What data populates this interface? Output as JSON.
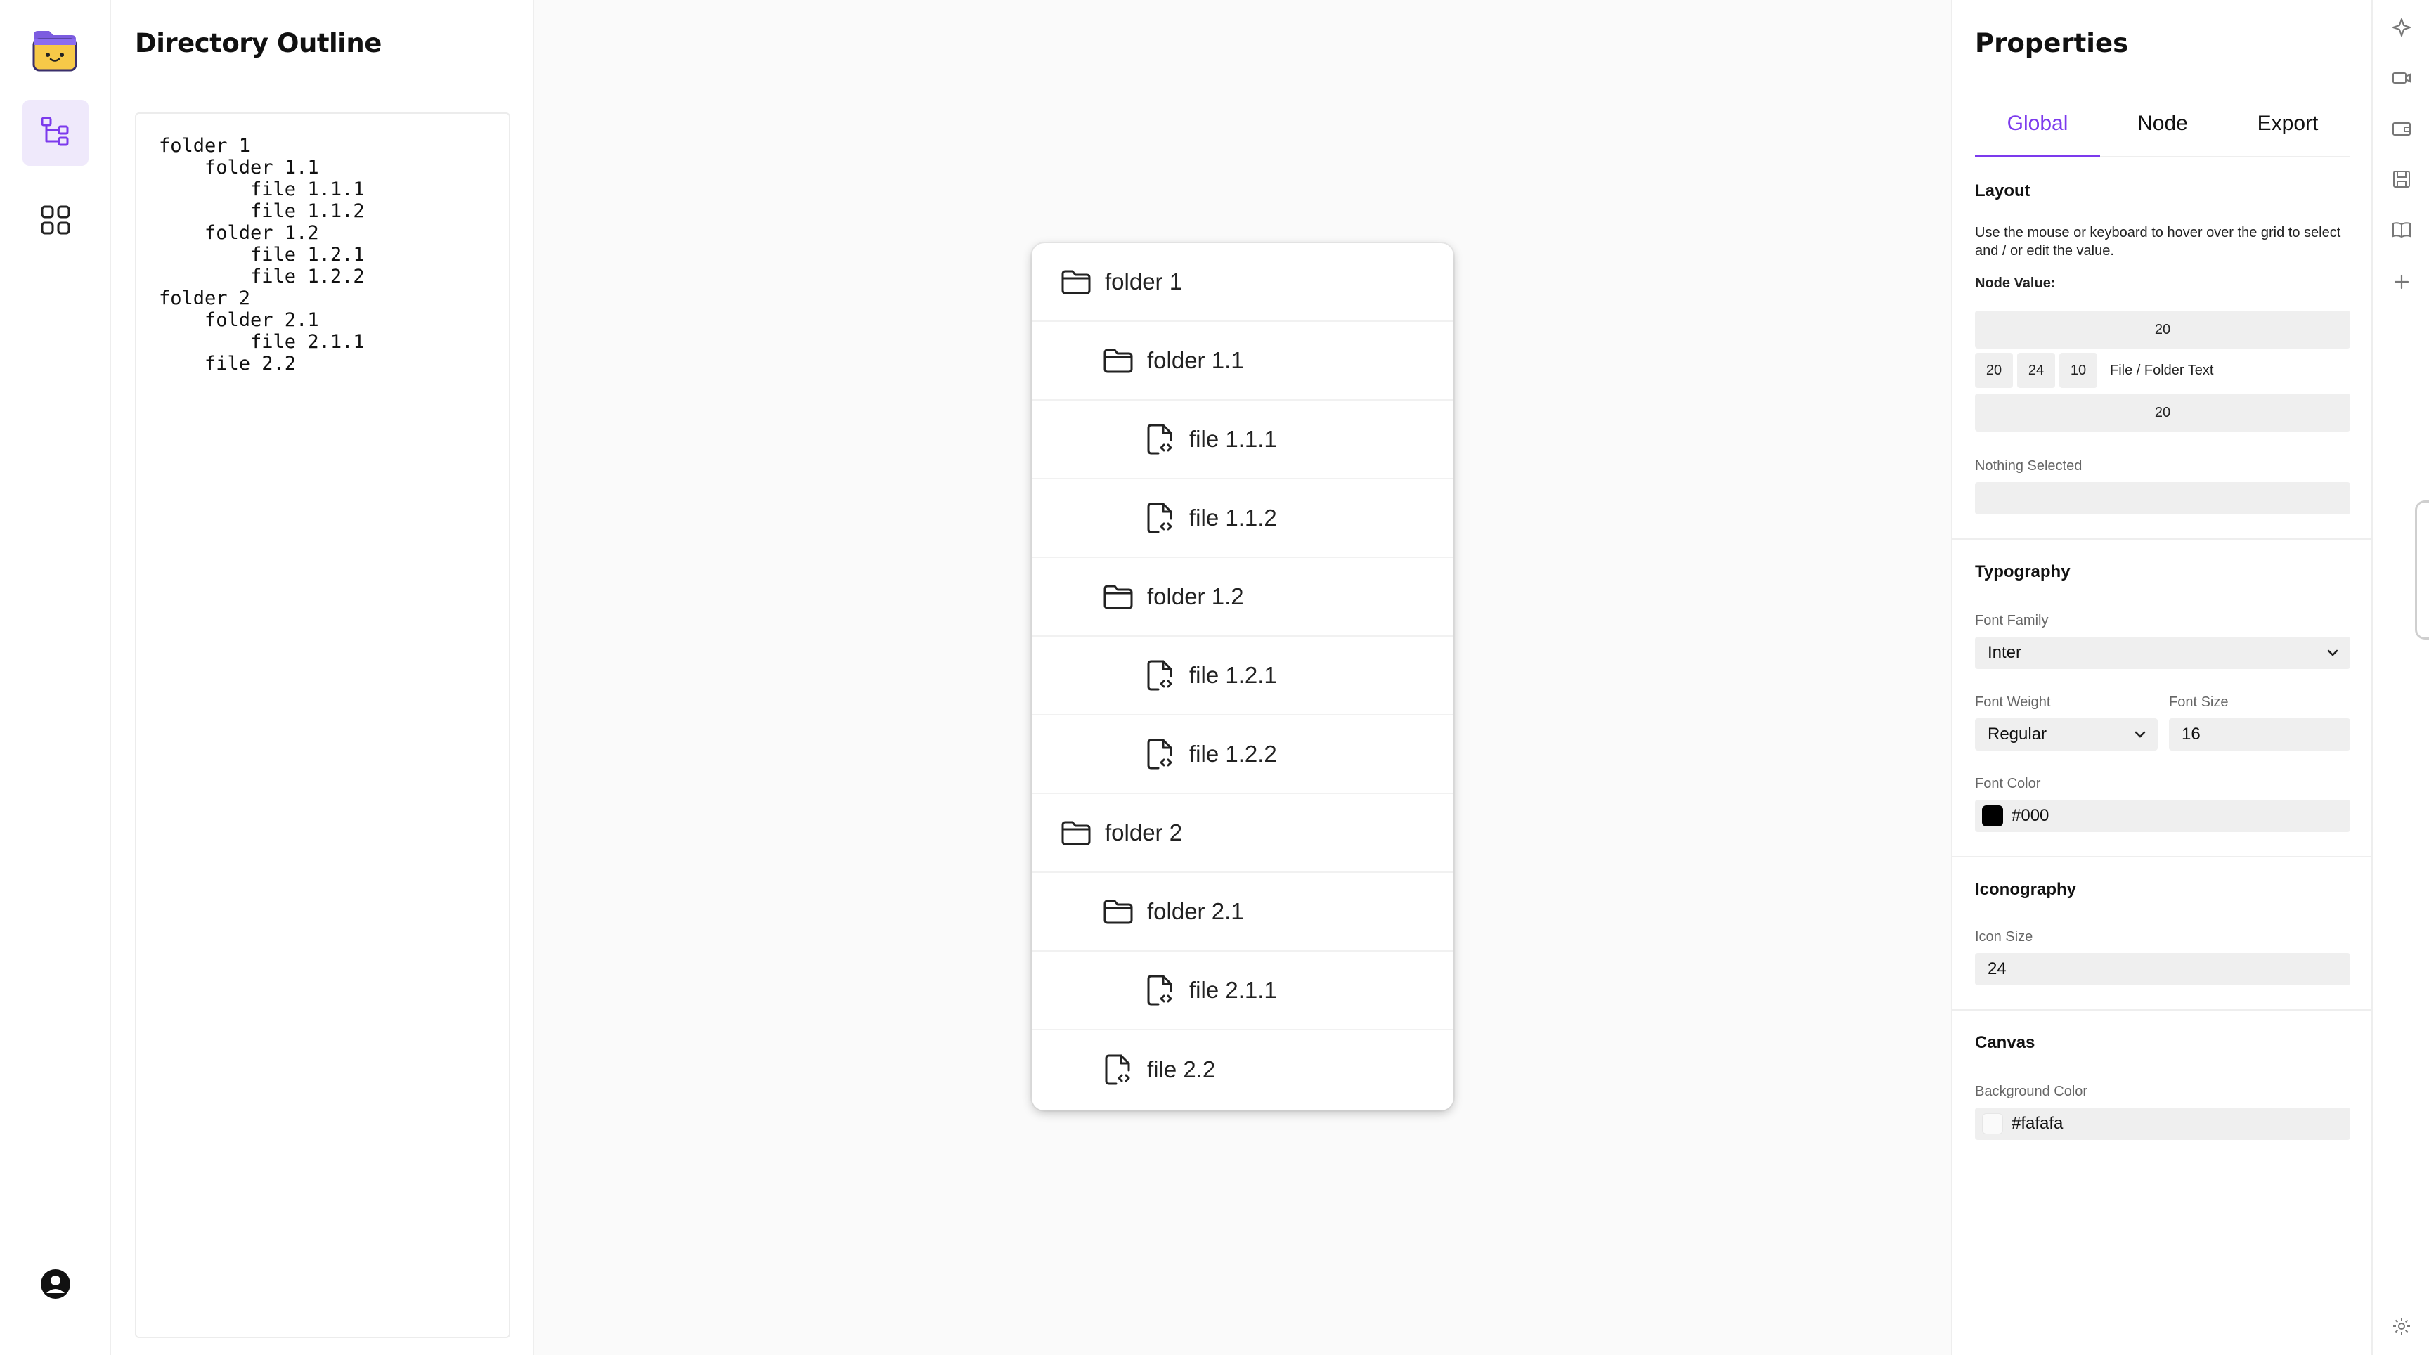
{
  "app": {
    "colors": {
      "accent": "#7c3aed",
      "rail_active_bg": "#efe9fb",
      "canvas_bg": "#fafafa"
    }
  },
  "rail": {
    "logo": "folder-face-logo-icon",
    "items": [
      {
        "name": "tree-view-icon",
        "active": true
      },
      {
        "name": "grid-view-icon",
        "active": false
      }
    ],
    "account": "account-icon"
  },
  "outline": {
    "title": "Directory Outline",
    "text": "folder 1\n    folder 1.1\n        file 1.1.1\n        file 1.1.2\n    folder 1.2\n        file 1.2.1\n        file 1.2.2\nfolder 2\n    folder 2.1\n        file 2.1.1\n    file 2.2"
  },
  "tree": {
    "rows": [
      {
        "label": "folder 1",
        "type": "folder",
        "depth": 0
      },
      {
        "label": "folder 1.1",
        "type": "folder",
        "depth": 1
      },
      {
        "label": "file 1.1.1",
        "type": "file",
        "depth": 2
      },
      {
        "label": "file 1.1.2",
        "type": "file",
        "depth": 2
      },
      {
        "label": "folder 1.2",
        "type": "folder",
        "depth": 1
      },
      {
        "label": "file 1.2.1",
        "type": "file",
        "depth": 2
      },
      {
        "label": "file 1.2.2",
        "type": "file",
        "depth": 2
      },
      {
        "label": "folder 2",
        "type": "folder",
        "depth": 0
      },
      {
        "label": "folder 2.1",
        "type": "folder",
        "depth": 1
      },
      {
        "label": "file 2.1.1",
        "type": "file",
        "depth": 2
      },
      {
        "label": "file 2.2",
        "type": "file",
        "depth": 1
      }
    ]
  },
  "properties": {
    "title": "Properties",
    "tabs": [
      {
        "label": "Global",
        "active": true
      },
      {
        "label": "Node",
        "active": false
      },
      {
        "label": "Export",
        "active": false
      }
    ],
    "layout": {
      "title": "Layout",
      "help": "Use the mouse or keyboard to hover over the grid to select and / or edit the value.",
      "node_value_label": "Node Value:",
      "top": "20",
      "left": "20",
      "icon": "24",
      "gap": "10",
      "text_label": "File / Folder Text",
      "bottom": "20",
      "selection_label": "Nothing Selected",
      "selection_value": ""
    },
    "typography": {
      "title": "Typography",
      "font_family_label": "Font Family",
      "font_family_value": "Inter",
      "font_weight_label": "Font Weight",
      "font_weight_value": "Regular",
      "font_size_label": "Font Size",
      "font_size_value": "16",
      "font_color_label": "Font Color",
      "font_color_value": "#000",
      "font_color_swatch": "#000000"
    },
    "iconography": {
      "title": "Iconography",
      "icon_size_label": "Icon Size",
      "icon_size_value": "24"
    },
    "canvas": {
      "title": "Canvas",
      "bg_label": "Background Color",
      "bg_value": "#fafafa",
      "bg_swatch": "#fafafa"
    }
  },
  "strip": {
    "icons": [
      "sparkle-icon",
      "video-icon",
      "wallet-icon",
      "save-icon",
      "book-icon",
      "plus-icon"
    ],
    "bottom_icon": "settings-gear-icon"
  }
}
